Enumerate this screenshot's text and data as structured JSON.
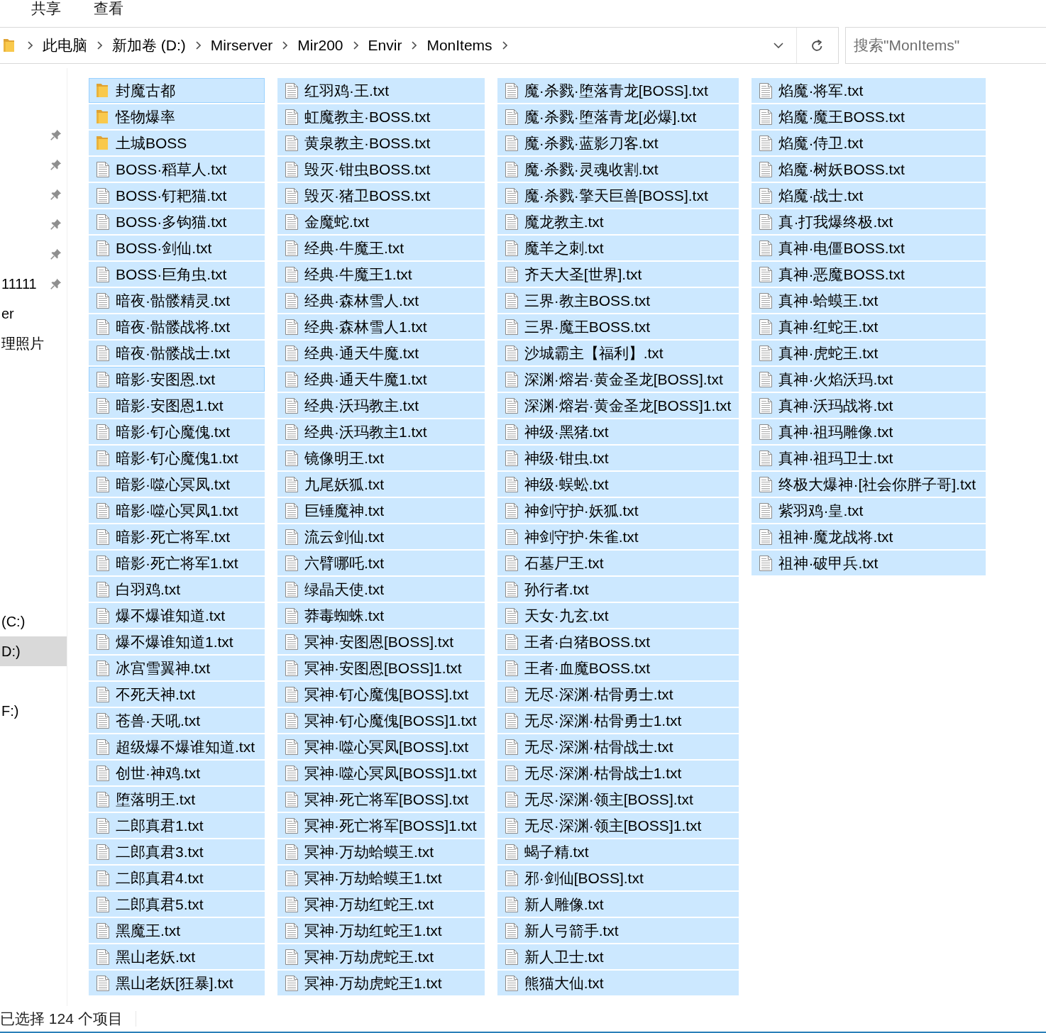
{
  "ribbon_tabs": [
    "共享",
    "查看"
  ],
  "address_bar": {
    "path": [
      "此电脑",
      "新加卷 (D:)",
      "Mirserver",
      "Mir200",
      "Envir",
      "MonItems"
    ]
  },
  "search": {
    "placeholder": "搜索\"MonItems\""
  },
  "navigation_pane": {
    "quick_access": [
      {
        "pinned": true
      },
      {
        "pinned": true
      },
      {
        "pinned": true
      },
      {
        "pinned": true
      },
      {
        "pinned": true
      },
      {
        "label": "11111",
        "pinned": true
      },
      {
        "label": "er",
        "pinned": false
      },
      {
        "label": "理照片",
        "pinned": false
      }
    ],
    "this_pc": [
      {
        "label": "(C:)",
        "selected": false
      },
      {
        "label": "D:)",
        "selected": true
      },
      {
        "label": "F:)",
        "selected": false
      }
    ]
  },
  "files": [
    {
      "name": "封魔古都",
      "kind": "folder",
      "selected": true,
      "focused": true
    },
    {
      "name": "怪物爆率",
      "kind": "folder",
      "selected": true,
      "focused": false
    },
    {
      "name": "土城BOSS",
      "kind": "folder",
      "selected": true,
      "focused": false
    },
    {
      "name": "BOSS·稻草人.txt",
      "kind": "file",
      "selected": true,
      "focused": false
    },
    {
      "name": "BOSS·钉耙猫.txt",
      "kind": "file",
      "selected": true,
      "focused": false
    },
    {
      "name": "BOSS·多钩猫.txt",
      "kind": "file",
      "selected": true,
      "focused": false
    },
    {
      "name": "BOSS·剑仙.txt",
      "kind": "file",
      "selected": true,
      "focused": false
    },
    {
      "name": "BOSS·巨角虫.txt",
      "kind": "file",
      "selected": true,
      "focused": false
    },
    {
      "name": "暗夜·骷髅精灵.txt",
      "kind": "file",
      "selected": true,
      "focused": false
    },
    {
      "name": "暗夜·骷髅战将.txt",
      "kind": "file",
      "selected": true,
      "focused": false
    },
    {
      "name": "暗夜·骷髅战士.txt",
      "kind": "file",
      "selected": true,
      "focused": false
    },
    {
      "name": "暗影·安图恩.txt",
      "kind": "file",
      "selected": true,
      "focused": true
    },
    {
      "name": "暗影·安图恩1.txt",
      "kind": "file",
      "selected": true,
      "focused": false
    },
    {
      "name": "暗影·钉心魔傀.txt",
      "kind": "file",
      "selected": true,
      "focused": false
    },
    {
      "name": "暗影·钉心魔傀1.txt",
      "kind": "file",
      "selected": true,
      "focused": false
    },
    {
      "name": "暗影·噬心冥凤.txt",
      "kind": "file",
      "selected": true,
      "focused": false
    },
    {
      "name": "暗影·噬心冥凤1.txt",
      "kind": "file",
      "selected": true,
      "focused": false
    },
    {
      "name": "暗影·死亡将军.txt",
      "kind": "file",
      "selected": true,
      "focused": false
    },
    {
      "name": "暗影·死亡将军1.txt",
      "kind": "file",
      "selected": true,
      "focused": false
    },
    {
      "name": "白羽鸡.txt",
      "kind": "file",
      "selected": true,
      "focused": false
    },
    {
      "name": "爆不爆谁知道.txt",
      "kind": "file",
      "selected": true,
      "focused": false
    },
    {
      "name": "爆不爆谁知道1.txt",
      "kind": "file",
      "selected": true,
      "focused": false
    },
    {
      "name": "冰宫雪翼神.txt",
      "kind": "file",
      "selected": true,
      "focused": false
    },
    {
      "name": "不死天神.txt",
      "kind": "file",
      "selected": true,
      "focused": false
    },
    {
      "name": "苍兽·天吼.txt",
      "kind": "file",
      "selected": true,
      "focused": false
    },
    {
      "name": "超级爆不爆谁知道.txt",
      "kind": "file",
      "selected": true,
      "focused": false
    },
    {
      "name": "创世·神鸡.txt",
      "kind": "file",
      "selected": true,
      "focused": false
    },
    {
      "name": "堕落明王.txt",
      "kind": "file",
      "selected": true,
      "focused": false
    },
    {
      "name": "二郎真君1.txt",
      "kind": "file",
      "selected": true,
      "focused": false
    },
    {
      "name": "二郎真君3.txt",
      "kind": "file",
      "selected": true,
      "focused": false
    },
    {
      "name": "二郎真君4.txt",
      "kind": "file",
      "selected": true,
      "focused": false
    },
    {
      "name": "二郎真君5.txt",
      "kind": "file",
      "selected": true,
      "focused": false
    },
    {
      "name": "黑魔王.txt",
      "kind": "file",
      "selected": true,
      "focused": false
    },
    {
      "name": "黑山老妖.txt",
      "kind": "file",
      "selected": true,
      "focused": false
    },
    {
      "name": "黑山老妖[狂暴].txt",
      "kind": "file",
      "selected": true,
      "focused": false
    },
    {
      "name": "红羽鸡·王.txt",
      "kind": "file",
      "selected": true,
      "focused": false
    },
    {
      "name": "虹魔教主·BOSS.txt",
      "kind": "file",
      "selected": true,
      "focused": false
    },
    {
      "name": "黄泉教主·BOSS.txt",
      "kind": "file",
      "selected": true,
      "focused": false
    },
    {
      "name": "毁灭·钳虫BOSS.txt",
      "kind": "file",
      "selected": true,
      "focused": false
    },
    {
      "name": "毁灭·猪卫BOSS.txt",
      "kind": "file",
      "selected": true,
      "focused": false
    },
    {
      "name": "金魔蛇.txt",
      "kind": "file",
      "selected": true,
      "focused": false
    },
    {
      "name": "经典·牛魔王.txt",
      "kind": "file",
      "selected": true,
      "focused": false
    },
    {
      "name": "经典·牛魔王1.txt",
      "kind": "file",
      "selected": true,
      "focused": false
    },
    {
      "name": "经典·森林雪人.txt",
      "kind": "file",
      "selected": true,
      "focused": false
    },
    {
      "name": "经典·森林雪人1.txt",
      "kind": "file",
      "selected": true,
      "focused": false
    },
    {
      "name": "经典·通天牛魔.txt",
      "kind": "file",
      "selected": true,
      "focused": false
    },
    {
      "name": "经典·通天牛魔1.txt",
      "kind": "file",
      "selected": true,
      "focused": false
    },
    {
      "name": "经典·沃玛教主.txt",
      "kind": "file",
      "selected": true,
      "focused": false
    },
    {
      "name": "经典·沃玛教主1.txt",
      "kind": "file",
      "selected": true,
      "focused": false
    },
    {
      "name": "镜像明王.txt",
      "kind": "file",
      "selected": true,
      "focused": false
    },
    {
      "name": "九尾妖狐.txt",
      "kind": "file",
      "selected": true,
      "focused": false
    },
    {
      "name": "巨锤魔神.txt",
      "kind": "file",
      "selected": true,
      "focused": false
    },
    {
      "name": "流云剑仙.txt",
      "kind": "file",
      "selected": true,
      "focused": false
    },
    {
      "name": "六臂哪吒.txt",
      "kind": "file",
      "selected": true,
      "focused": false
    },
    {
      "name": "绿晶天使.txt",
      "kind": "file",
      "selected": true,
      "focused": false
    },
    {
      "name": "莽毒蜘蛛.txt",
      "kind": "file",
      "selected": true,
      "focused": false
    },
    {
      "name": "冥神·安图恩[BOSS].txt",
      "kind": "file",
      "selected": true,
      "focused": false
    },
    {
      "name": "冥神·安图恩[BOSS]1.txt",
      "kind": "file",
      "selected": true,
      "focused": false
    },
    {
      "name": "冥神·钉心魔傀[BOSS].txt",
      "kind": "file",
      "selected": true,
      "focused": false
    },
    {
      "name": "冥神·钉心魔傀[BOSS]1.txt",
      "kind": "file",
      "selected": true,
      "focused": false
    },
    {
      "name": "冥神·噬心冥凤[BOSS].txt",
      "kind": "file",
      "selected": true,
      "focused": false
    },
    {
      "name": "冥神·噬心冥凤[BOSS]1.txt",
      "kind": "file",
      "selected": true,
      "focused": false
    },
    {
      "name": "冥神·死亡将军[BOSS].txt",
      "kind": "file",
      "selected": true,
      "focused": false
    },
    {
      "name": "冥神·死亡将军[BOSS]1.txt",
      "kind": "file",
      "selected": true,
      "focused": false
    },
    {
      "name": "冥神·万劫蛤蟆王.txt",
      "kind": "file",
      "selected": true,
      "focused": false
    },
    {
      "name": "冥神·万劫蛤蟆王1.txt",
      "kind": "file",
      "selected": true,
      "focused": false
    },
    {
      "name": "冥神·万劫红蛇王.txt",
      "kind": "file",
      "selected": true,
      "focused": false
    },
    {
      "name": "冥神·万劫红蛇王1.txt",
      "kind": "file",
      "selected": true,
      "focused": false
    },
    {
      "name": "冥神·万劫虎蛇王.txt",
      "kind": "file",
      "selected": true,
      "focused": false
    },
    {
      "name": "冥神·万劫虎蛇王1.txt",
      "kind": "file",
      "selected": true,
      "focused": false
    },
    {
      "name": "魔·杀戮·堕落青龙[BOSS].txt",
      "kind": "file",
      "selected": true,
      "focused": false
    },
    {
      "name": "魔·杀戮·堕落青龙[必爆].txt",
      "kind": "file",
      "selected": true,
      "focused": false
    },
    {
      "name": "魔·杀戮·蓝影刀客.txt",
      "kind": "file",
      "selected": true,
      "focused": false
    },
    {
      "name": "魔·杀戮·灵魂收割.txt",
      "kind": "file",
      "selected": true,
      "focused": false
    },
    {
      "name": "魔·杀戮·擎天巨兽[BOSS].txt",
      "kind": "file",
      "selected": true,
      "focused": false
    },
    {
      "name": "魔龙教主.txt",
      "kind": "file",
      "selected": true,
      "focused": false
    },
    {
      "name": "魔羊之刺.txt",
      "kind": "file",
      "selected": true,
      "focused": false
    },
    {
      "name": "齐天大圣[世界].txt",
      "kind": "file",
      "selected": true,
      "focused": false
    },
    {
      "name": "三界·教主BOSS.txt",
      "kind": "file",
      "selected": true,
      "focused": false
    },
    {
      "name": "三界·魔王BOSS.txt",
      "kind": "file",
      "selected": true,
      "focused": false
    },
    {
      "name": "沙城霸主【福利】.txt",
      "kind": "file",
      "selected": true,
      "focused": false
    },
    {
      "name": "深渊·熔岩·黄金圣龙[BOSS].txt",
      "kind": "file",
      "selected": true,
      "focused": false
    },
    {
      "name": "深渊·熔岩·黄金圣龙[BOSS]1.txt",
      "kind": "file",
      "selected": true,
      "focused": false
    },
    {
      "name": "神级·黑猪.txt",
      "kind": "file",
      "selected": true,
      "focused": false
    },
    {
      "name": "神级·钳虫.txt",
      "kind": "file",
      "selected": true,
      "focused": false
    },
    {
      "name": "神级·蜈蚣.txt",
      "kind": "file",
      "selected": true,
      "focused": false
    },
    {
      "name": "神剑守护·妖狐.txt",
      "kind": "file",
      "selected": true,
      "focused": false
    },
    {
      "name": "神剑守护·朱雀.txt",
      "kind": "file",
      "selected": true,
      "focused": false
    },
    {
      "name": "石墓尸王.txt",
      "kind": "file",
      "selected": true,
      "focused": false
    },
    {
      "name": "孙行者.txt",
      "kind": "file",
      "selected": true,
      "focused": false
    },
    {
      "name": "天女·九玄.txt",
      "kind": "file",
      "selected": true,
      "focused": false
    },
    {
      "name": "王者·白猪BOSS.txt",
      "kind": "file",
      "selected": true,
      "focused": false
    },
    {
      "name": "王者·血魔BOSS.txt",
      "kind": "file",
      "selected": true,
      "focused": false
    },
    {
      "name": "无尽·深渊·枯骨勇士.txt",
      "kind": "file",
      "selected": true,
      "focused": false
    },
    {
      "name": "无尽·深渊·枯骨勇士1.txt",
      "kind": "file",
      "selected": true,
      "focused": false
    },
    {
      "name": "无尽·深渊·枯骨战士.txt",
      "kind": "file",
      "selected": true,
      "focused": false
    },
    {
      "name": "无尽·深渊·枯骨战士1.txt",
      "kind": "file",
      "selected": true,
      "focused": false
    },
    {
      "name": "无尽·深渊·领主[BOSS].txt",
      "kind": "file",
      "selected": true,
      "focused": false
    },
    {
      "name": "无尽·深渊·领主[BOSS]1.txt",
      "kind": "file",
      "selected": true,
      "focused": false
    },
    {
      "name": "蝎子精.txt",
      "kind": "file",
      "selected": true,
      "focused": false
    },
    {
      "name": "邪·剑仙[BOSS].txt",
      "kind": "file",
      "selected": true,
      "focused": false
    },
    {
      "name": "新人雕像.txt",
      "kind": "file",
      "selected": true,
      "focused": false
    },
    {
      "name": "新人弓箭手.txt",
      "kind": "file",
      "selected": true,
      "focused": false
    },
    {
      "name": "新人卫士.txt",
      "kind": "file",
      "selected": true,
      "focused": false
    },
    {
      "name": "熊猫大仙.txt",
      "kind": "file",
      "selected": true,
      "focused": false
    },
    {
      "name": "焰魔·将军.txt",
      "kind": "file",
      "selected": true,
      "focused": false
    },
    {
      "name": "焰魔·魔王BOSS.txt",
      "kind": "file",
      "selected": true,
      "focused": false
    },
    {
      "name": "焰魔·侍卫.txt",
      "kind": "file",
      "selected": true,
      "focused": false
    },
    {
      "name": "焰魔·树妖BOSS.txt",
      "kind": "file",
      "selected": true,
      "focused": false
    },
    {
      "name": "焰魔·战士.txt",
      "kind": "file",
      "selected": true,
      "focused": false
    },
    {
      "name": "真·打我爆终极.txt",
      "kind": "file",
      "selected": true,
      "focused": false
    },
    {
      "name": "真神·电僵BOSS.txt",
      "kind": "file",
      "selected": true,
      "focused": false
    },
    {
      "name": "真神·恶魔BOSS.txt",
      "kind": "file",
      "selected": true,
      "focused": false
    },
    {
      "name": "真神·蛤蟆王.txt",
      "kind": "file",
      "selected": true,
      "focused": false
    },
    {
      "name": "真神·红蛇王.txt",
      "kind": "file",
      "selected": true,
      "focused": false
    },
    {
      "name": "真神·虎蛇王.txt",
      "kind": "file",
      "selected": true,
      "focused": false
    },
    {
      "name": "真神·火焰沃玛.txt",
      "kind": "file",
      "selected": true,
      "focused": false
    },
    {
      "name": "真神·沃玛战将.txt",
      "kind": "file",
      "selected": true,
      "focused": false
    },
    {
      "name": "真神·祖玛雕像.txt",
      "kind": "file",
      "selected": true,
      "focused": false
    },
    {
      "name": "真神·祖玛卫士.txt",
      "kind": "file",
      "selected": true,
      "focused": false
    },
    {
      "name": "终极大爆神·[社会你胖子哥].txt",
      "kind": "file",
      "selected": true,
      "focused": false
    },
    {
      "name": "紫羽鸡·皇.txt",
      "kind": "file",
      "selected": true,
      "focused": false
    },
    {
      "name": "祖神·魔龙战将.txt",
      "kind": "file",
      "selected": true,
      "focused": false
    },
    {
      "name": "祖神·破甲兵.txt",
      "kind": "file",
      "selected": true,
      "focused": false
    }
  ],
  "status_bar": {
    "text": "已选择 124 个项目"
  }
}
